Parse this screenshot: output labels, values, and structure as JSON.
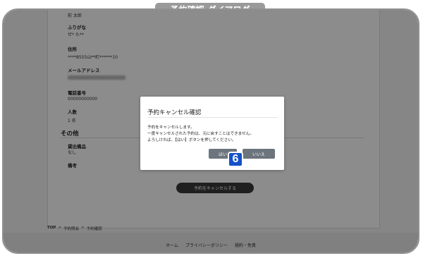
{
  "header": {
    "title": "予約確認-ダイアログ"
  },
  "fields": {
    "name_value": "前 太郎",
    "furigana_label": "ふりがな",
    "furigana_value": "ぜ* た**",
    "address_label": "住所",
    "address_value": "****8555山**町******10",
    "email_label": "メールアドレス",
    "phone_label": "電話番号",
    "phone_value": "00000000000",
    "people_label": "人数",
    "people_value": "1 名"
  },
  "other_section": {
    "title": "その他",
    "rental_label": "貸出備品",
    "rental_value": "なし",
    "notes_label": "備考"
  },
  "cancel_reservation_button": "予約をキャンセルする",
  "breadcrumb": {
    "top": "TOP",
    "sep1": ">",
    "item1": "予約照会",
    "sep2": ">",
    "item2": "予約確認"
  },
  "footer": {
    "home": "ホーム",
    "privacy": "プライバシーポリシー",
    "terms": "規約・免責"
  },
  "dialog": {
    "title": "予約キャンセル確認",
    "line1": "予約をキャンセルします。",
    "line2": "一度キャンセルされた予約は、元に戻すことはできません。",
    "line3": "よろしければ、【はい】ボタンを押してください。",
    "yes": "はい",
    "no": "いいえ"
  },
  "step_badge": "6"
}
